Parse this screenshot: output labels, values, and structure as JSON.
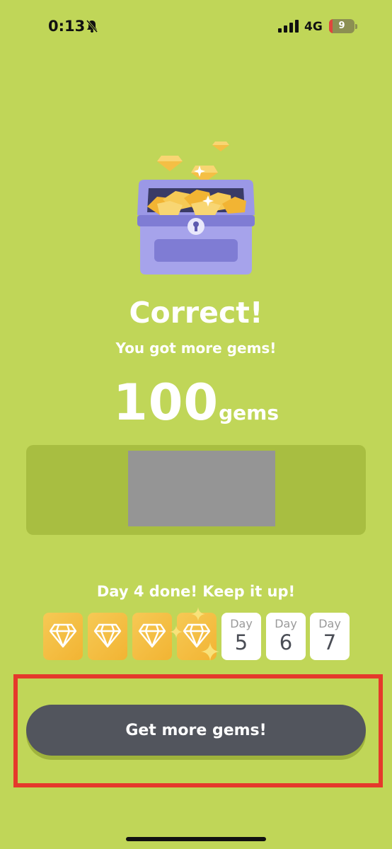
{
  "status_bar": {
    "time": "0:13",
    "network": "4G",
    "battery": "9",
    "battery_level": 0.09,
    "icons": [
      "bell-slash-icon",
      "signal-icon",
      "battery-charging-icon"
    ]
  },
  "reward": {
    "title": "Correct!",
    "subtitle": "You got more gems!",
    "amount": "100",
    "unit": "gems",
    "illustration": "treasure-chest-icon"
  },
  "streak": {
    "message": "Day 4 done! Keep it up!",
    "days": [
      {
        "status": "done",
        "icon": "diamond-icon"
      },
      {
        "status": "done",
        "icon": "diamond-icon"
      },
      {
        "status": "done",
        "icon": "diamond-icon"
      },
      {
        "status": "done",
        "icon": "diamond-icon"
      },
      {
        "status": "pending",
        "label": "Day",
        "number": "5"
      },
      {
        "status": "pending",
        "label": "Day",
        "number": "6"
      },
      {
        "status": "pending",
        "label": "Day",
        "number": "7"
      }
    ]
  },
  "cta": {
    "label": "Get more gems!"
  },
  "colors": {
    "background": "#c0d658",
    "button": "#52555d",
    "highlight": "#e5392b",
    "gem_gold": "#f4bf45"
  }
}
